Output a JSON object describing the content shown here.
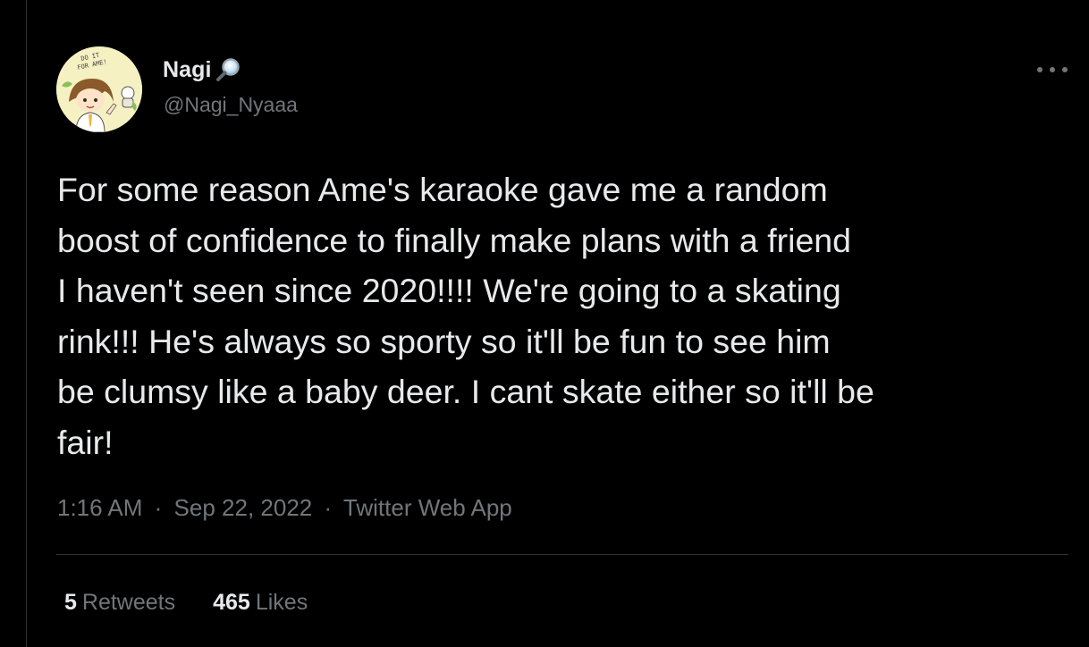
{
  "tweet": {
    "author": {
      "display_name": "Nagi",
      "handle": "@Nagi_Nyaaa",
      "name_emoji_icon": "magnifying-glass-icon",
      "avatar_text": "DO IT FOR AME!"
    },
    "text": "For some reason Ame's karaoke gave me a random\nboost of confidence to finally make plans with a friend\nI haven't seen since 2020!!!! We're going to a skating\nrink!!! He's always so sporty so it'll be fun to see him\nbe clumsy like a baby deer. I cant skate either so it'll be\nfair!",
    "time": "1:16 AM",
    "date": "Sep 22, 2022",
    "separator": "·",
    "source": "Twitter Web App",
    "stats": {
      "retweets_count": "5",
      "retweets_label": "Retweets",
      "likes_count": "465",
      "likes_label": "Likes"
    }
  },
  "colors": {
    "background": "#000000",
    "primary_text": "#e7e9ea",
    "secondary_text": "#71767b",
    "divider": "#2f3336"
  }
}
